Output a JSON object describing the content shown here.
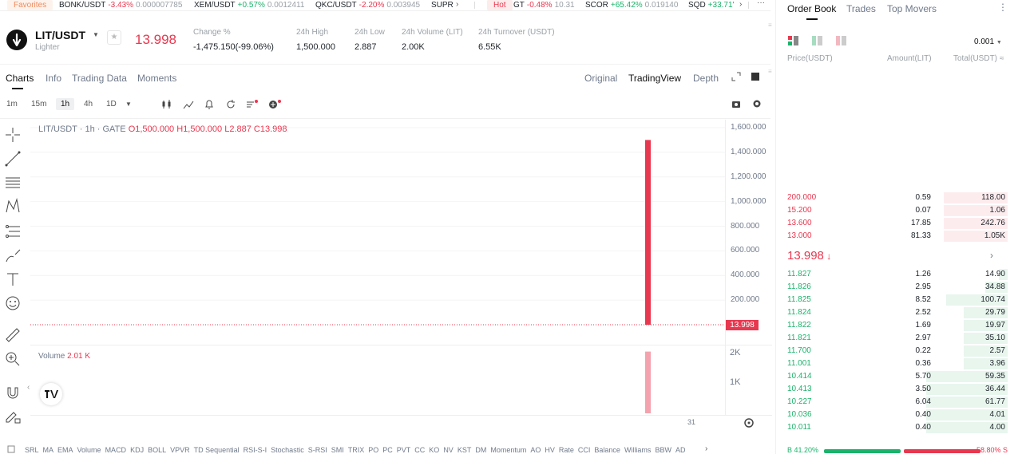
{
  "ticker": {
    "favorites_label": "Favorites",
    "favorites_items": [
      {
        "symbol": "BONK/USDT",
        "change": "-3.43%",
        "price": "0.000007785",
        "dir": "down"
      },
      {
        "symbol": "XEM/USDT",
        "change": "+0.57%",
        "price": "0.0012411",
        "dir": "up"
      },
      {
        "symbol": "QKC/USDT",
        "change": "-2.20%",
        "price": "0.003945",
        "dir": "down"
      },
      {
        "symbol": "SUPR",
        "change": "",
        "price": "",
        "dir": "none"
      }
    ],
    "hot_label": "Hot",
    "hot_items": [
      {
        "symbol": "GT",
        "change": "-0.48%",
        "price": "10.31",
        "dir": "down"
      },
      {
        "symbol": "SCOR",
        "change": "+65.42%",
        "price": "0.019140",
        "dir": "up"
      },
      {
        "symbol": "SQD",
        "change": "+33.71'",
        "price": "",
        "dir": "up"
      }
    ],
    "more": "···"
  },
  "pair": {
    "symbol": "LIT/USDT",
    "subtitle": "Lighter",
    "last_price": "13.998",
    "stats": [
      {
        "label": "Change %",
        "value": "-1,475.150(-99.06%)",
        "color": "red"
      },
      {
        "label": "24h High",
        "value": "1,500.000",
        "color": "normal"
      },
      {
        "label": "24h Low",
        "value": "2.887",
        "color": "normal"
      },
      {
        "label": "24h Volume (LIT)",
        "value": "2.00K",
        "color": "normal"
      },
      {
        "label": "24h Turnover (USDT)",
        "value": "6.55K",
        "color": "normal"
      }
    ]
  },
  "tabs": {
    "charts": "Charts",
    "info": "Info",
    "trading_data": "Trading Data",
    "moments": "Moments",
    "original": "Original",
    "tradingview": "TradingView",
    "depth": "Depth"
  },
  "intervals": [
    "1m",
    "15m",
    "1h",
    "4h",
    "1D"
  ],
  "active_interval": "1h",
  "chart_data": {
    "type": "bar",
    "legend": {
      "title": "LIT/USDT · 1h · GATE",
      "o": "O1,500.000",
      "h": "H1,500.000",
      "l": "L2.887",
      "c": "C13.998"
    },
    "price_ticks": [
      "1,600.000",
      "1,400.000",
      "1,200.000",
      "1,000.000",
      "800.000",
      "600.000",
      "400.000",
      "200.000"
    ],
    "price_tick_values": [
      1600000,
      1400000,
      1200000,
      1000000,
      800000,
      600000,
      400000,
      200000
    ],
    "ylim": [
      0,
      1600000
    ],
    "candles": [
      {
        "open": 1500000,
        "high": 1500000,
        "low": 2.887,
        "close": 13.998
      }
    ],
    "current_price": "13.998",
    "volume_label": "Volume",
    "volume_value": "2.01 K",
    "volume_ticks": [
      "2K",
      "1K"
    ],
    "volume_bars": [
      2010
    ],
    "x_tick": "31"
  },
  "indicators": [
    "SRL",
    "MA",
    "EMA",
    "Volume",
    "MACD",
    "KDJ",
    "BOLL",
    "VPVR",
    "TD Sequential",
    "RSI-S-I",
    "Stochastic",
    "S-RSI",
    "SMI",
    "TRIX",
    "PO",
    "PC",
    "PVT",
    "CC",
    "KO",
    "NV",
    "KST",
    "DM",
    "Momentum",
    "AO",
    "HV",
    "Rate",
    "CCI",
    "Balance",
    "Williams",
    "BBW",
    "AD"
  ],
  "order_book": {
    "tabs": [
      "Order Book",
      "Trades",
      "Top Movers"
    ],
    "precision": "0.001",
    "columns": {
      "price": "Price(USDT)",
      "amount": "Amount(LIT)",
      "total": "Total(USDT)"
    },
    "asks": [
      {
        "price": "200.000",
        "amount": "0.59",
        "total": "118.00",
        "depth": 0.29
      },
      {
        "price": "15.200",
        "amount": "0.07",
        "total": "1.06",
        "depth": 0.29
      },
      {
        "price": "13.600",
        "amount": "17.85",
        "total": "242.76",
        "depth": 0.29
      },
      {
        "price": "13.000",
        "amount": "81.33",
        "total": "1.05K",
        "depth": 0.29
      }
    ],
    "mid_price": "13.998",
    "bids": [
      {
        "price": "11.827",
        "amount": "1.26",
        "total": "14.90",
        "depth": 0.04
      },
      {
        "price": "11.826",
        "amount": "2.95",
        "total": "34.88",
        "depth": 0.1
      },
      {
        "price": "11.825",
        "amount": "8.52",
        "total": "100.74",
        "depth": 0.28
      },
      {
        "price": "11.824",
        "amount": "2.52",
        "total": "29.79",
        "depth": 0.2
      },
      {
        "price": "11.822",
        "amount": "1.69",
        "total": "19.97",
        "depth": 0.2
      },
      {
        "price": "11.821",
        "amount": "2.97",
        "total": "35.10",
        "depth": 0.2
      },
      {
        "price": "11.700",
        "amount": "0.22",
        "total": "2.57",
        "depth": 0.2
      },
      {
        "price": "11.001",
        "amount": "0.36",
        "total": "3.96",
        "depth": 0.2
      },
      {
        "price": "10.414",
        "amount": "5.70",
        "total": "59.35",
        "depth": 0.37
      },
      {
        "price": "10.413",
        "amount": "3.50",
        "total": "36.44",
        "depth": 0.37
      },
      {
        "price": "10.227",
        "amount": "6.04",
        "total": "61.77",
        "depth": 0.37
      },
      {
        "price": "10.036",
        "amount": "0.40",
        "total": "4.01",
        "depth": 0.37
      },
      {
        "price": "10.011",
        "amount": "0.40",
        "total": "4.00",
        "depth": 0.37
      }
    ],
    "buy_ratio": "B 41.20%",
    "sell_ratio": "58.80% S"
  }
}
